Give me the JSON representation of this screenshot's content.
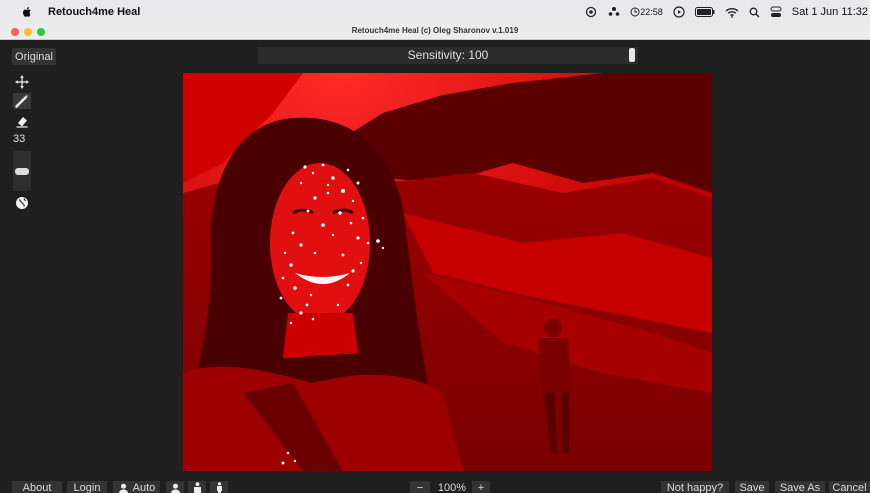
{
  "menubar": {
    "app_name": "Retouch4me Heal",
    "time_small": "22:58",
    "datetime": "Sat 1 Jun 11:32"
  },
  "window": {
    "title": "Retouch4me Heal (c) Oleg Sharonov v.1.019"
  },
  "toolbar": {
    "original_label": "Original",
    "sensitivity_label": "Sensitivity: 100",
    "sensitivity_value": 100
  },
  "tools": {
    "brush_size": "33",
    "slider_level": 0.5
  },
  "bottom": {
    "about_label": "About",
    "login_label": "Login",
    "auto_label": "Auto",
    "zoom_minus": "−",
    "zoom_value": "100%",
    "zoom_plus": "+",
    "not_happy_label": "Not happy?",
    "save_label": "Save",
    "save_as_label": "Save As",
    "cancel_label": "Cancel"
  },
  "colors": {
    "overlay_red": "#d90000",
    "app_bg": "#1f1f1f",
    "button_bg": "#333333"
  },
  "icons": {
    "move": "move-icon",
    "brush": "brush-icon",
    "eraser": "eraser-icon",
    "globe": "globe-icon",
    "person": "person-icon"
  }
}
